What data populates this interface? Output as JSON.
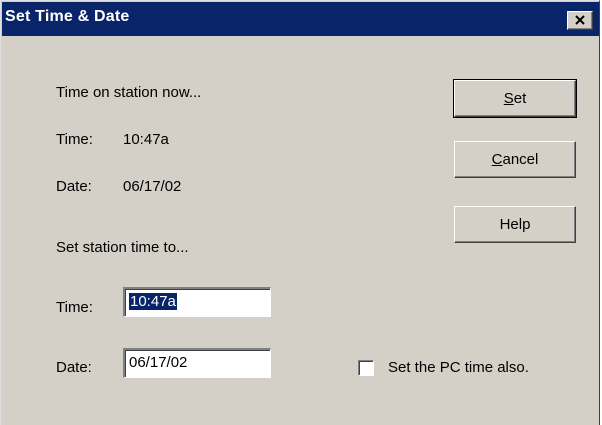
{
  "window": {
    "title": "Set Time & Date",
    "close_icon": "close-icon"
  },
  "current": {
    "heading": "Time on station now...",
    "time_label": "Time:",
    "time_value": "10:47a",
    "date_label": "Date:",
    "date_value": "06/17/02"
  },
  "new_setting": {
    "heading": "Set station time to...",
    "time_label": "Time:",
    "time_value": "10:47a",
    "date_label": "Date:",
    "date_value": "06/17/02"
  },
  "buttons": {
    "set_mnemonic": "S",
    "set_rest": "et",
    "cancel_mnemonic": "C",
    "cancel_rest": "ancel",
    "help": "Help"
  },
  "options": {
    "set_pc_time_label": "Set the PC time also.",
    "set_pc_time_checked": false
  },
  "colors": {
    "titlebar": "#0a246a",
    "face": "#d4d0c8",
    "selection": "#0a246a"
  }
}
